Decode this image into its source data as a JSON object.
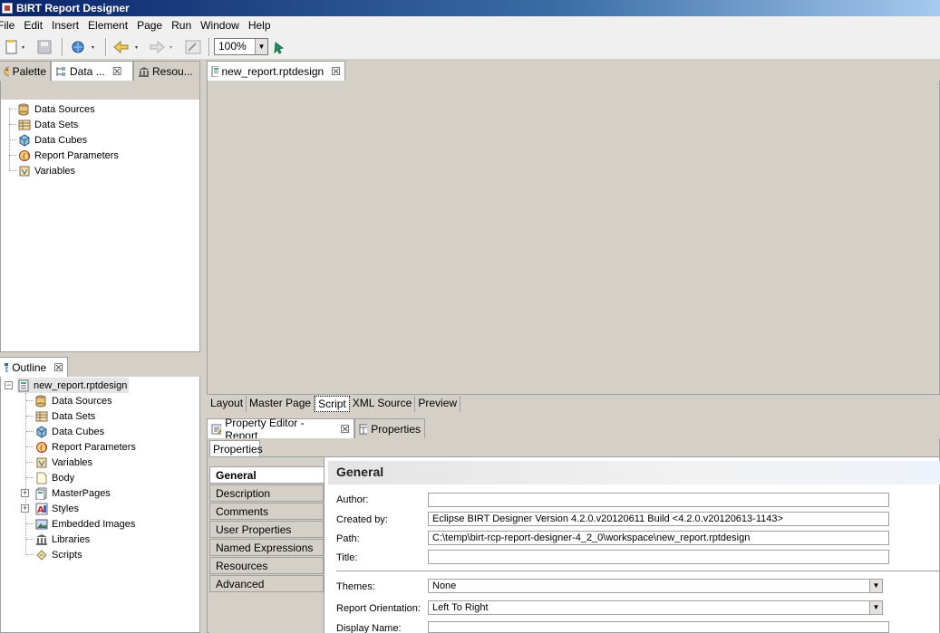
{
  "window": {
    "title": "BIRT Report Designer"
  },
  "menu": [
    "File",
    "Edit",
    "Insert",
    "Element",
    "Page",
    "Run",
    "Window",
    "Help"
  ],
  "toolbar": {
    "zoom": "100%"
  },
  "left_top_tabs": [
    {
      "label": "Palette",
      "icon": "palette-icon"
    },
    {
      "label": "Data ...",
      "icon": "data-explorer-icon",
      "active": true
    },
    {
      "label": "Resou...",
      "icon": "resource-explorer-icon"
    }
  ],
  "data_tree": [
    "Data Sources",
    "Data Sets",
    "Data Cubes",
    "Report Parameters",
    "Variables"
  ],
  "outline": {
    "tab_label": "Outline",
    "root": "new_report.rptdesign",
    "items": [
      "Data Sources",
      "Data Sets",
      "Data Cubes",
      "Report Parameters",
      "Variables",
      "Body",
      "MasterPages",
      "Styles",
      "Embedded Images",
      "Libraries",
      "Scripts"
    ]
  },
  "editor": {
    "tab_label": "new_report.rptdesign",
    "bottom_tabs": [
      "Layout",
      "Master Page",
      "Script",
      "XML Source",
      "Preview"
    ],
    "active_bottom_tab": "Script"
  },
  "property_editor": {
    "tabs": [
      "Property Editor - Report",
      "Properties"
    ],
    "subtab": "Properties",
    "categories": [
      "General",
      "Description",
      "Comments",
      "User Properties",
      "Named Expressions",
      "Resources",
      "Advanced"
    ],
    "heading": "General",
    "fields": {
      "author_label": "Author:",
      "author_value": "",
      "created_by_label": "Created by:",
      "created_by_value": "Eclipse BIRT Designer Version 4.2.0.v20120611 Build <4.2.0.v20120613-1143>",
      "path_label": "Path:",
      "path_value": "C:\\temp\\birt-rcp-report-designer-4_2_0\\workspace\\new_report.rptdesign",
      "title_label": "Title:",
      "title_value": "",
      "themes_label": "Themes:",
      "themes_value": "None",
      "orientation_label": "Report Orientation:",
      "orientation_value": "Left To Right",
      "display_name_label": "Display Name:",
      "display_name_value": ""
    }
  }
}
